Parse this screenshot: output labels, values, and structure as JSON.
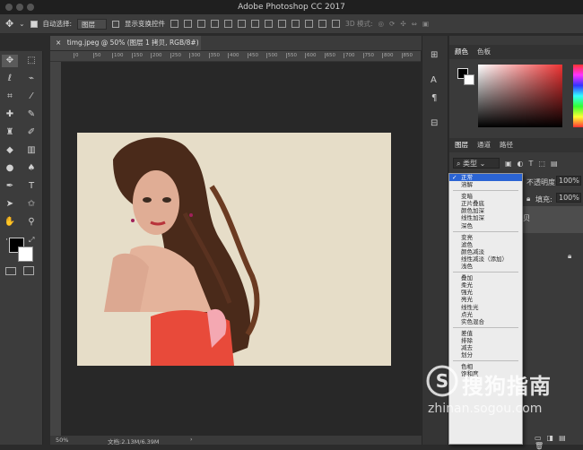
{
  "app": {
    "title": "Adobe Photoshop CC 2017"
  },
  "options_bar": {
    "auto_select_label": "自动选择:",
    "auto_select_value": "图层",
    "show_transform_label": "显示变换控件",
    "mode_3d_label": "3D 模式:"
  },
  "document": {
    "tab_title": "timg.jpeg @ 50% (图层 1 拷贝, RGB/8#) *",
    "zoom": "50%",
    "file_info": "文档:2.13M/6.39M"
  },
  "ruler_ticks": [
    "0",
    "50",
    "100",
    "150",
    "200",
    "250",
    "300",
    "350",
    "400",
    "450",
    "500",
    "550",
    "600",
    "650",
    "700",
    "750",
    "800",
    "850"
  ],
  "color_panel": {
    "tabs": [
      "颜色",
      "色板"
    ]
  },
  "layers_panel": {
    "tabs": [
      "图层",
      "通道",
      "路径"
    ],
    "filter_label": "类型",
    "opacity_label": "不透明度:",
    "opacity_value": "100%",
    "fill_label": "填充:",
    "fill_value": "100%",
    "layer_name_partial": "贝"
  },
  "blend_menu": {
    "groups": [
      [
        "正常",
        "溶解"
      ],
      [
        "变暗",
        "正片叠底",
        "颜色加深",
        "线性加深",
        "深色"
      ],
      [
        "变亮",
        "滤色",
        "颜色减淡",
        "线性减淡（添加）",
        "浅色"
      ],
      [
        "叠加",
        "柔光",
        "强光",
        "亮光",
        "线性光",
        "点光",
        "实色混合"
      ],
      [
        "差值",
        "排除",
        "减去",
        "划分"
      ],
      [
        "色相",
        "饱和度"
      ]
    ],
    "selected": "正常"
  },
  "watermark": {
    "brand": "搜狗指南",
    "url": "zhinan.sogou.com"
  },
  "colors": {
    "accent": "#2b64d3",
    "dress": "#e84a3a",
    "bg": "#2b2b2b"
  }
}
